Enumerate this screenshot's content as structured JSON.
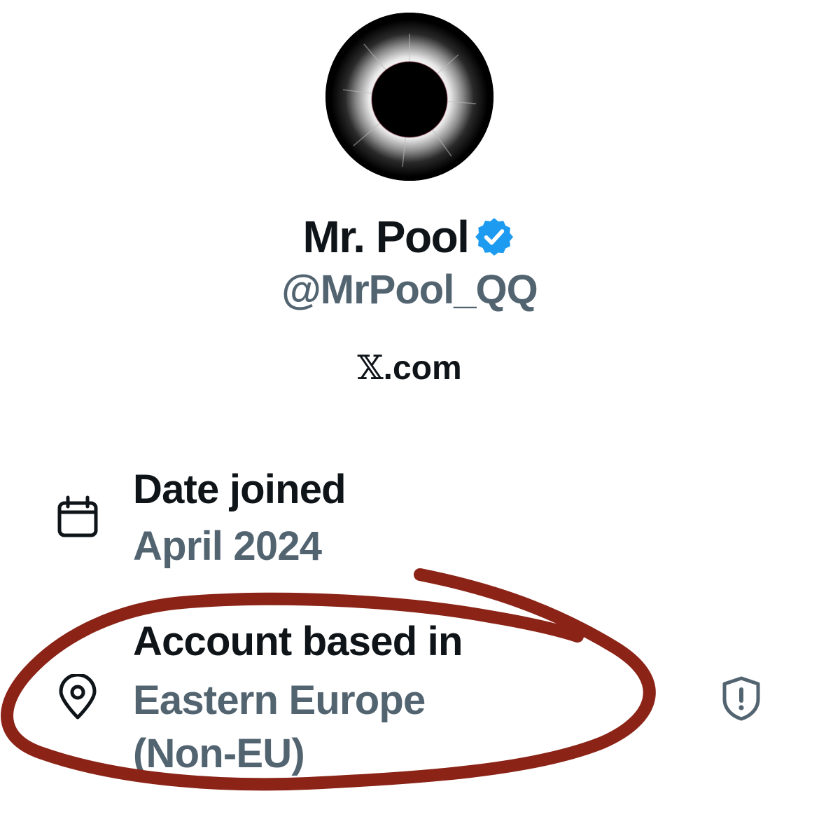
{
  "profile": {
    "display_name": "Mr. Pool",
    "handle": "@MrPool_QQ",
    "source_x": "𝕏",
    "source_suffix": ".com"
  },
  "about": {
    "date_joined": {
      "label": "Date joined",
      "value": "April 2024"
    },
    "account_based_in": {
      "label": "Account based in",
      "value_line1": "Eastern Europe",
      "value_line2": "(Non-EU)"
    }
  },
  "icons": {
    "date_joined": "calendar-icon",
    "account_based_in": "location-pin-icon",
    "info": "shield-alert-icon",
    "verified": "verified-badge-icon"
  },
  "colors": {
    "primary_text": "#0f1419",
    "secondary_text": "#536471",
    "verified_blue": "#1d9bf0",
    "annotation_red": "#8b2317"
  }
}
